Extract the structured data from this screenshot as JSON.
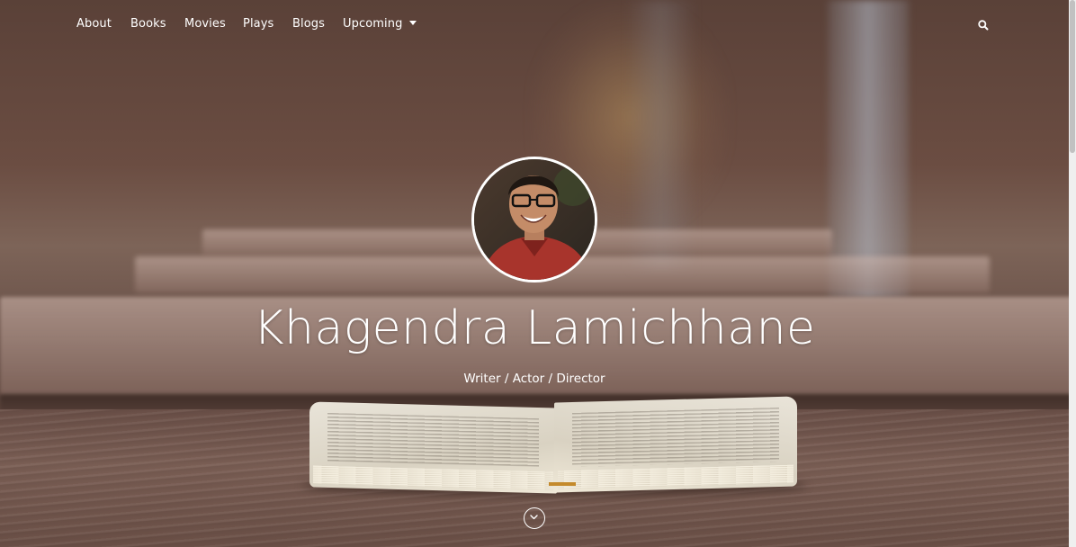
{
  "nav": {
    "items": [
      {
        "label": "About"
      },
      {
        "label": "Books"
      },
      {
        "label": "Movies"
      },
      {
        "label": "Plays"
      },
      {
        "label": "Blogs"
      },
      {
        "label": "Upcoming"
      }
    ],
    "search_icon": "search-icon",
    "dropdown_icon": "caret-down-icon"
  },
  "hero": {
    "name": "Khagendra Lamichhane",
    "subtitle": "Writer / Actor / Director",
    "avatar_icon": "profile-photo",
    "scroll_icon": "chevron-down-circle-icon"
  },
  "colors": {
    "text": "#ffffff",
    "background_tone": "#5a4138"
  }
}
